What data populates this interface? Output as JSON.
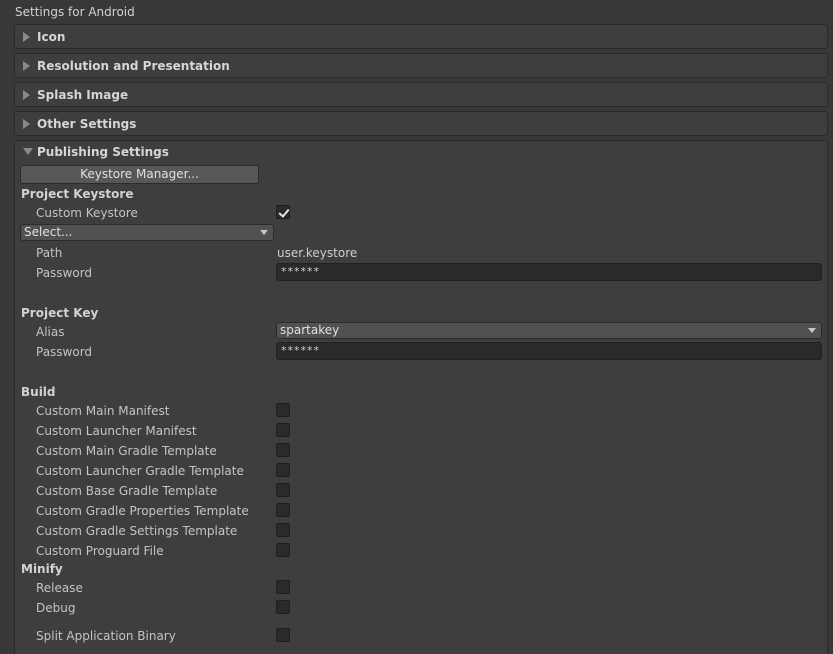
{
  "window": {
    "title": "Settings for Android"
  },
  "sections": [
    {
      "label": "Icon"
    },
    {
      "label": "Resolution and Presentation"
    },
    {
      "label": "Splash Image"
    },
    {
      "label": "Other Settings"
    }
  ],
  "publishing": {
    "label": "Publishing Settings",
    "keystore_manager_button": "Keystore Manager...",
    "project_keystore": {
      "heading": "Project Keystore",
      "custom_keystore_label": "Custom Keystore",
      "custom_keystore_checked": true,
      "select_value": "Select...",
      "path_label": "Path",
      "path_value": "user.keystore",
      "password_label": "Password",
      "password_value": "******"
    },
    "project_key": {
      "heading": "Project Key",
      "alias_label": "Alias",
      "alias_value": "spartakey",
      "password_label": "Password",
      "password_value": "******"
    },
    "build": {
      "heading": "Build",
      "items": [
        {
          "label": "Custom Main Manifest",
          "checked": false
        },
        {
          "label": "Custom Launcher Manifest",
          "checked": false
        },
        {
          "label": "Custom Main Gradle Template",
          "checked": false
        },
        {
          "label": "Custom Launcher Gradle Template",
          "checked": false
        },
        {
          "label": "Custom Base Gradle Template",
          "checked": false
        },
        {
          "label": "Custom Gradle Properties Template",
          "checked": false
        },
        {
          "label": "Custom Gradle Settings Template",
          "checked": false
        },
        {
          "label": "Custom Proguard File",
          "checked": false
        }
      ]
    },
    "minify": {
      "heading": "Minify",
      "items": [
        {
          "label": "Release",
          "checked": false
        },
        {
          "label": "Debug",
          "checked": false
        }
      ]
    },
    "split_binary": {
      "label": "Split Application Binary",
      "checked": false
    }
  },
  "colors": {
    "background": "#383838",
    "panel": "#3e3e3e",
    "field": "#2a2a2a",
    "button": "#585858"
  }
}
